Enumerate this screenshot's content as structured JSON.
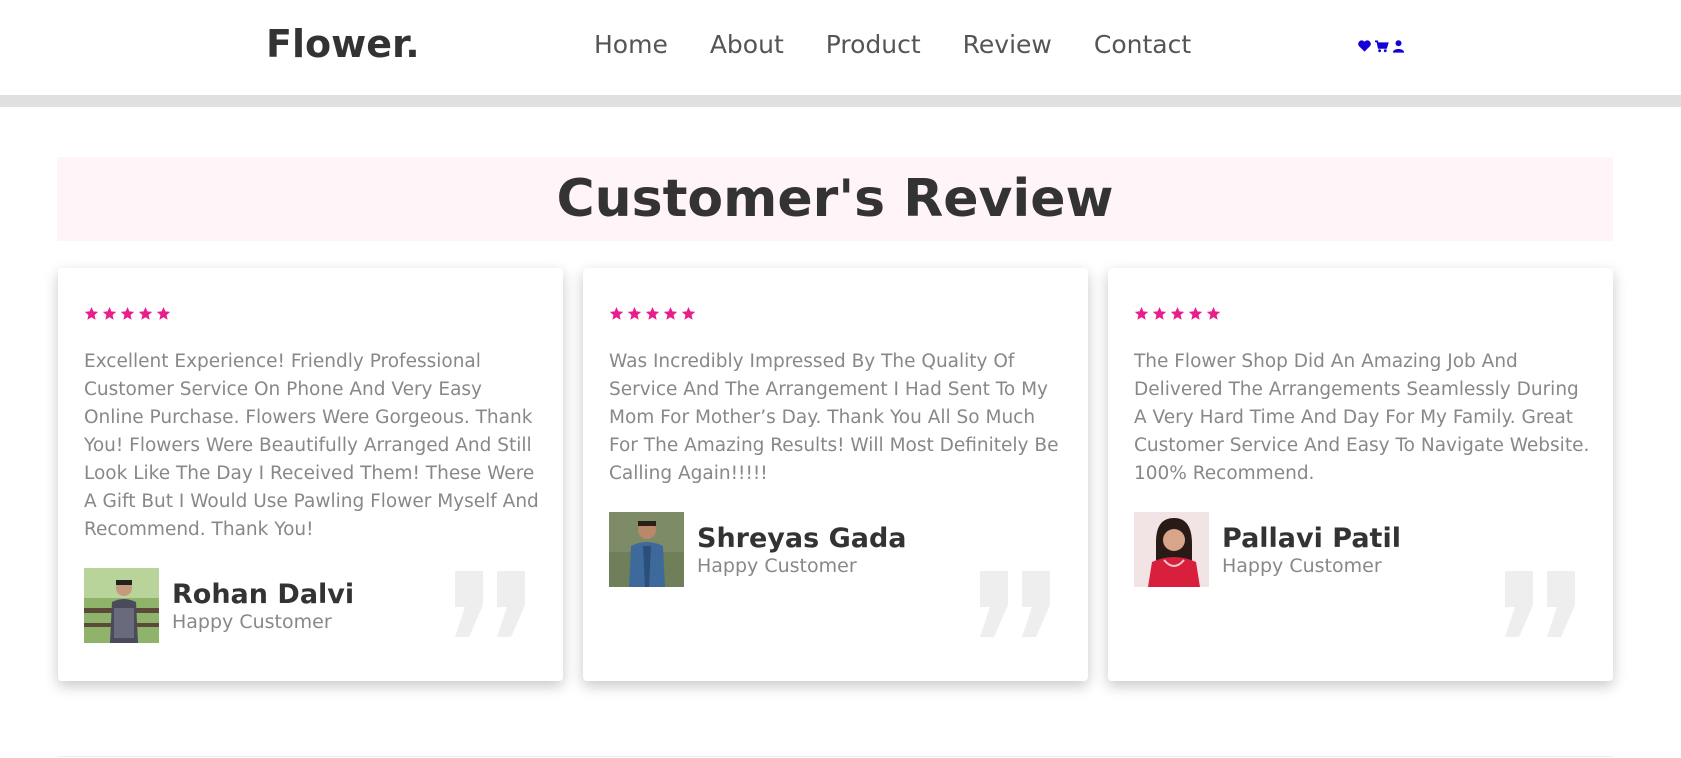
{
  "header": {
    "logo": "Flower.",
    "nav": [
      "Home",
      "About",
      "Product",
      "Review",
      "Contact"
    ],
    "icons": [
      "heart-icon",
      "cart-icon",
      "user-icon"
    ],
    "icon_color": "#1400d8"
  },
  "section": {
    "title": "Customer's Review",
    "title_bg": "#fff4f8"
  },
  "reviews": [
    {
      "stars": 5,
      "text": "Excellent Experience! Friendly Professional Customer Service On Phone And Very Easy Online Purchase. Flowers Were Gorgeous. Thank You! Flowers Were Beautifully Arranged And Still Look Like The Day I Received Them! These Were A Gift But I Would Use Pawling Flower Myself And Recommend. Thank You!",
      "name": "Rohan Dalvi",
      "role": "Happy Customer"
    },
    {
      "stars": 5,
      "text": "Was Incredibly Impressed By The Quality Of Service And The Arrangement I Had Sent To My Mom For Mother’s Day. Thank You All So Much For The Amazing Results! Will Most Definitely Be Calling Again!!!!!",
      "name": "Shreyas Gada",
      "role": "Happy Customer"
    },
    {
      "stars": 5,
      "text": "The Flower Shop Did An Amazing Job And Delivered The Arrangements Seamlessly During A Very Hard Time And Day For My Family. Great Customer Service And Easy To Navigate Website. 100% Recommend.",
      "name": "Pallavi Patil",
      "role": "Happy Customer"
    }
  ],
  "colors": {
    "star": "#e91e8c",
    "quote": "#eeeeee"
  }
}
